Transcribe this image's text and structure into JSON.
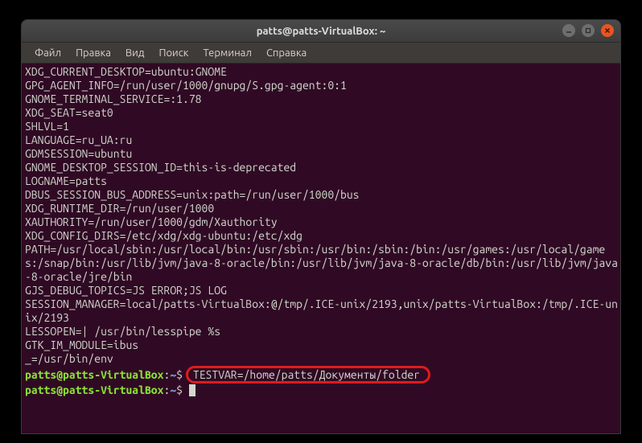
{
  "window": {
    "title": "patts@patts-VirtualBox: ~"
  },
  "menubar": {
    "items": [
      "Файл",
      "Правка",
      "Вид",
      "Поиск",
      "Терминал",
      "Справка"
    ]
  },
  "terminal": {
    "lines": [
      "XDG_CURRENT_DESKTOP=ubuntu:GNOME",
      "GPG_AGENT_INFO=/run/user/1000/gnupg/S.gpg-agent:0:1",
      "GNOME_TERMINAL_SERVICE=:1.78",
      "XDG_SEAT=seat0",
      "SHLVL=1",
      "LANGUAGE=ru_UA:ru",
      "GDMSESSION=ubuntu",
      "GNOME_DESKTOP_SESSION_ID=this-is-deprecated",
      "LOGNAME=patts",
      "DBUS_SESSION_BUS_ADDRESS=unix:path=/run/user/1000/bus",
      "XDG_RUNTIME_DIR=/run/user/1000",
      "XAUTHORITY=/run/user/1000/gdm/Xauthority",
      "XDG_CONFIG_DIRS=/etc/xdg/xdg-ubuntu:/etc/xdg",
      "PATH=/usr/local/sbin:/usr/local/bin:/usr/sbin:/usr/bin:/sbin:/bin:/usr/games:/usr/local/games:/snap/bin:/usr/lib/jvm/java-8-oracle/bin:/usr/lib/jvm/java-8-oracle/db/bin:/usr/lib/jvm/java-8-oracle/jre/bin",
      "GJS_DEBUG_TOPICS=JS ERROR;JS LOG",
      "SESSION_MANAGER=local/patts-VirtualBox:@/tmp/.ICE-unix/2193,unix/patts-VirtualBox:/tmp/.ICE-unix/2193",
      "LESSOPEN=| /usr/bin/lesspipe %s",
      "GTK_IM_MODULE=ibus",
      "_=/usr/bin/env"
    ],
    "prompt_user": "patts@patts-VirtualBox",
    "prompt_path": "~",
    "prompt_symbol": "$",
    "command": "TESTVAR=/home/patts/Документы/folder"
  }
}
